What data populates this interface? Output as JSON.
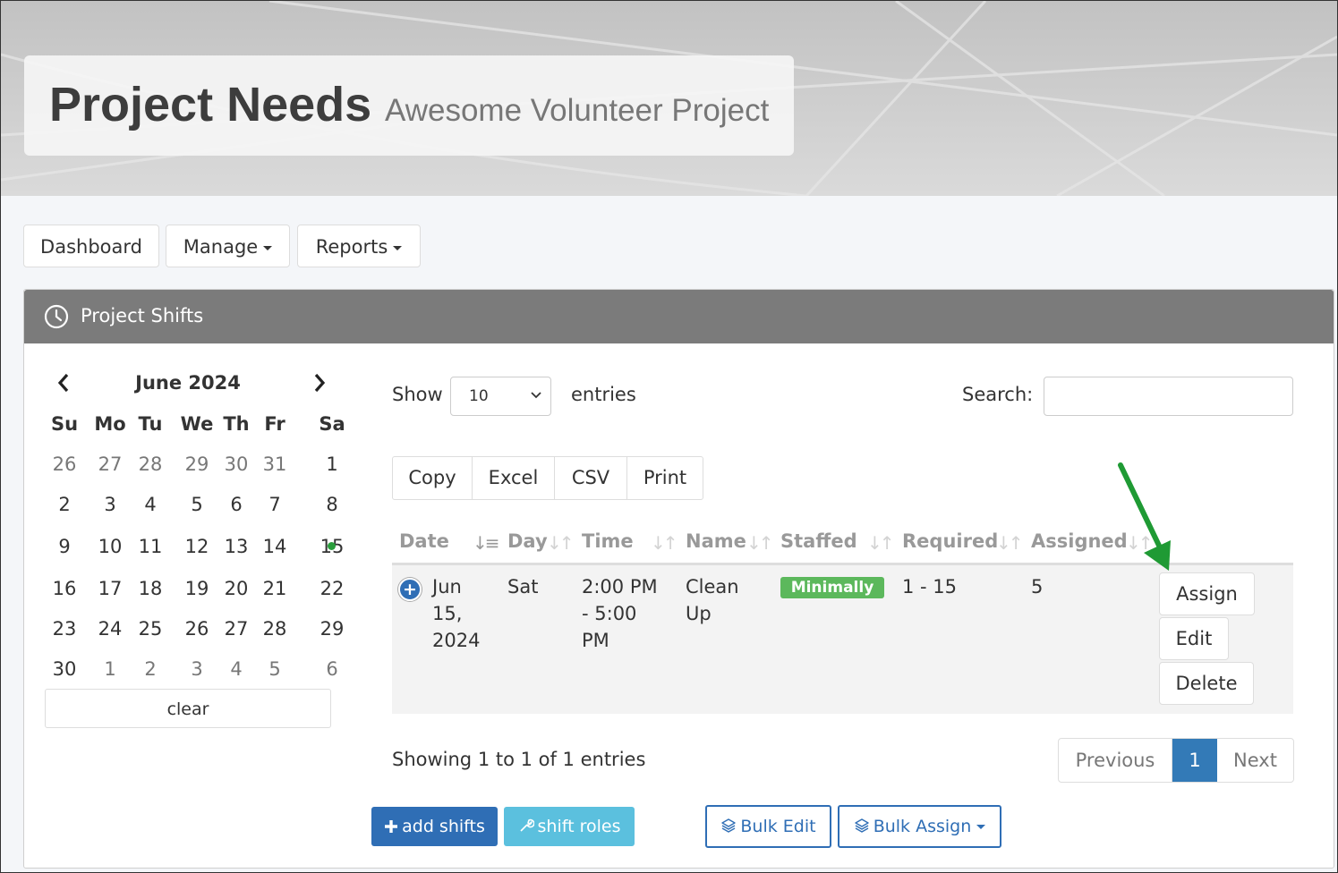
{
  "header": {
    "title": "Project Needs",
    "subtitle": "Awesome Volunteer Project"
  },
  "nav": {
    "dashboard": "Dashboard",
    "manage": "Manage",
    "reports": "Reports"
  },
  "panel": {
    "title": "Project Shifts"
  },
  "calendar": {
    "month_label": "June 2024",
    "weekdays": [
      "Su",
      "Mo",
      "Tu",
      "We",
      "Th",
      "Fr",
      "Sa"
    ],
    "weeks": [
      [
        "26",
        "27",
        "28",
        "29",
        "30",
        "31",
        "1"
      ],
      [
        "2",
        "3",
        "4",
        "5",
        "6",
        "7",
        "8"
      ],
      [
        "9",
        "10",
        "11",
        "12",
        "13",
        "14",
        "15"
      ],
      [
        "16",
        "17",
        "18",
        "19",
        "20",
        "21",
        "22"
      ],
      [
        "23",
        "24",
        "25",
        "26",
        "27",
        "28",
        "29"
      ],
      [
        "30",
        "1",
        "2",
        "3",
        "4",
        "5",
        "6"
      ]
    ],
    "highlighted_day": "15",
    "clear_label": "clear"
  },
  "table_controls": {
    "show_label": "Show",
    "entries_value": "10",
    "entries_label": "entries",
    "search_label": "Search:",
    "search_value": ""
  },
  "export_buttons": [
    "Copy",
    "Excel",
    "CSV",
    "Print"
  ],
  "table": {
    "columns": [
      "Date",
      "Day",
      "Time",
      "Name",
      "Staffed",
      "Required",
      "Assigned"
    ],
    "row": {
      "date_line1": "Jun",
      "date_line2": "15,",
      "date_line3": "2024",
      "day": "Sat",
      "time_line1": "2:00 PM",
      "time_line2": "- 5:00",
      "time_line3": "PM",
      "name_line1": "Clean",
      "name_line2": "Up",
      "staffed": "Minimally",
      "required": "1 - 15",
      "assigned": "5",
      "actions": [
        "Assign",
        "Edit",
        "Delete"
      ]
    }
  },
  "footer": {
    "info": "Showing 1 to 1 of 1 entries"
  },
  "pagination": {
    "previous": "Previous",
    "current": "1",
    "next": "Next"
  },
  "bottom_buttons": {
    "add_shifts": "add shifts",
    "shift_roles": "shift roles",
    "bulk_edit": "Bulk Edit",
    "bulk_assign": "Bulk Assign"
  },
  "colors": {
    "primary": "#337ab7",
    "info": "#5bc0de",
    "success": "#5cb85c",
    "panel_header": "#7b7b7b",
    "annotation_arrow": "#1f9a34"
  }
}
